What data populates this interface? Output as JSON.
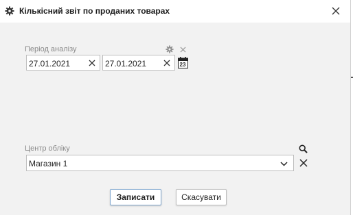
{
  "dialog": {
    "title": "Кількісний звіт по проданих товарах",
    "icons": {
      "title": "gear-icon",
      "close": "close-icon"
    }
  },
  "period": {
    "label": "Період аналізу",
    "date_from": "27.01.2021",
    "date_to": "27.01.2021",
    "calendar_day": "23",
    "icons": {
      "settings": "gear-icon",
      "clear": "close-icon",
      "calendar": "calendar-icon"
    }
  },
  "account_center": {
    "label": "Центр обліку",
    "value": "Магазин 1",
    "icons": {
      "search": "search-icon",
      "dropdown": "chevron-down-icon",
      "clear": "close-icon"
    }
  },
  "buttons": {
    "save": "Записати",
    "cancel": "Скасувати"
  },
  "colors": {
    "dialog_background": "#f2f2f2",
    "primary_button_border": "#7ea6cf",
    "label_text": "#8a8a8a"
  }
}
